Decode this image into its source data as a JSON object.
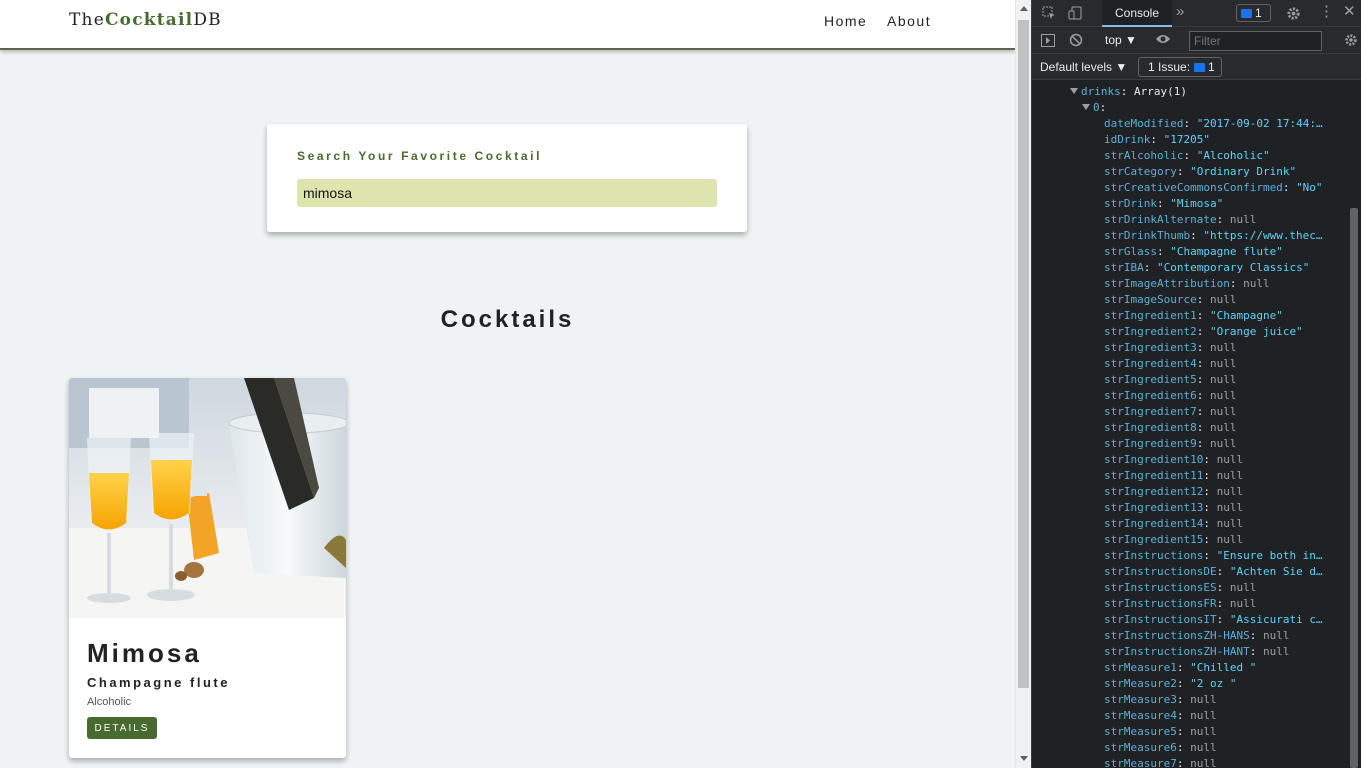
{
  "navbar": {
    "logo_prefix": "The",
    "logo_bold": "Cocktail",
    "logo_suffix": "DB",
    "links": [
      "Home",
      "About"
    ]
  },
  "search": {
    "label": "Search Your Favorite Cocktail",
    "value": "mimosa"
  },
  "section_title": "Cocktails",
  "cards": [
    {
      "name": "Mimosa",
      "glass": "Champagne flute",
      "alcoholic": "Alcoholic",
      "button": "DETAILS"
    }
  ],
  "devtools": {
    "tab": "Console",
    "message_count": "1",
    "context": "top",
    "filter_placeholder": "Filter",
    "levels": "Default levels",
    "issues_label": "1 Issue:",
    "issues_count": "1",
    "root_key": "drinks",
    "root_value": "Array(1)",
    "index_key": "0",
    "props": [
      {
        "key": "dateModified",
        "value": "\"2017-09-02 17:44:…",
        "type": "string"
      },
      {
        "key": "idDrink",
        "value": "\"17205\"",
        "type": "string"
      },
      {
        "key": "strAlcoholic",
        "value": "\"Alcoholic\"",
        "type": "string"
      },
      {
        "key": "strCategory",
        "value": "\"Ordinary Drink\"",
        "type": "string"
      },
      {
        "key": "strCreativeCommonsConfirmed",
        "value": "\"No\"",
        "type": "string"
      },
      {
        "key": "strDrink",
        "value": "\"Mimosa\"",
        "type": "string"
      },
      {
        "key": "strDrinkAlternate",
        "value": "null",
        "type": "null"
      },
      {
        "key": "strDrinkThumb",
        "value": "\"https://www.thec…",
        "type": "string"
      },
      {
        "key": "strGlass",
        "value": "\"Champagne flute\"",
        "type": "string"
      },
      {
        "key": "strIBA",
        "value": "\"Contemporary Classics\"",
        "type": "string"
      },
      {
        "key": "strImageAttribution",
        "value": "null",
        "type": "null"
      },
      {
        "key": "strImageSource",
        "value": "null",
        "type": "null"
      },
      {
        "key": "strIngredient1",
        "value": "\"Champagne\"",
        "type": "string"
      },
      {
        "key": "strIngredient2",
        "value": "\"Orange juice\"",
        "type": "string"
      },
      {
        "key": "strIngredient3",
        "value": "null",
        "type": "null"
      },
      {
        "key": "strIngredient4",
        "value": "null",
        "type": "null"
      },
      {
        "key": "strIngredient5",
        "value": "null",
        "type": "null"
      },
      {
        "key": "strIngredient6",
        "value": "null",
        "type": "null"
      },
      {
        "key": "strIngredient7",
        "value": "null",
        "type": "null"
      },
      {
        "key": "strIngredient8",
        "value": "null",
        "type": "null"
      },
      {
        "key": "strIngredient9",
        "value": "null",
        "type": "null"
      },
      {
        "key": "strIngredient10",
        "value": "null",
        "type": "null"
      },
      {
        "key": "strIngredient11",
        "value": "null",
        "type": "null"
      },
      {
        "key": "strIngredient12",
        "value": "null",
        "type": "null"
      },
      {
        "key": "strIngredient13",
        "value": "null",
        "type": "null"
      },
      {
        "key": "strIngredient14",
        "value": "null",
        "type": "null"
      },
      {
        "key": "strIngredient15",
        "value": "null",
        "type": "null"
      },
      {
        "key": "strInstructions",
        "value": "\"Ensure both in…",
        "type": "string"
      },
      {
        "key": "strInstructionsDE",
        "value": "\"Achten Sie d…",
        "type": "string"
      },
      {
        "key": "strInstructionsES",
        "value": "null",
        "type": "null"
      },
      {
        "key": "strInstructionsFR",
        "value": "null",
        "type": "null"
      },
      {
        "key": "strInstructionsIT",
        "value": "\"Assicurati c…",
        "type": "string"
      },
      {
        "key": "strInstructionsZH-HANS",
        "value": "null",
        "type": "null"
      },
      {
        "key": "strInstructionsZH-HANT",
        "value": "null",
        "type": "null"
      },
      {
        "key": "strMeasure1",
        "value": "\"Chilled \"",
        "type": "string"
      },
      {
        "key": "strMeasure2",
        "value": "\"2 oz \"",
        "type": "string"
      },
      {
        "key": "strMeasure3",
        "value": "null",
        "type": "null"
      },
      {
        "key": "strMeasure4",
        "value": "null",
        "type": "null"
      },
      {
        "key": "strMeasure5",
        "value": "null",
        "type": "null"
      },
      {
        "key": "strMeasure6",
        "value": "null",
        "type": "null"
      },
      {
        "key": "strMeasure7",
        "value": "null",
        "type": "null"
      }
    ]
  }
}
